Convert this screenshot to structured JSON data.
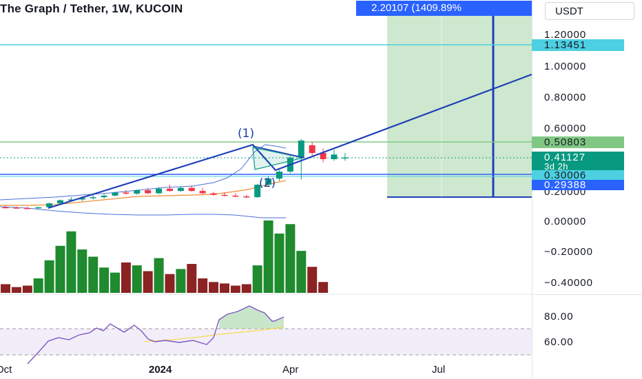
{
  "header": {
    "symbol_title": "The Graph / Tether, 1W, KUCOIN",
    "measure_label": "2.20107 (1409.89%",
    "currency": "USDT"
  },
  "price_axis": {
    "labels": [
      "1.20000",
      "1.00000",
      "0.80000",
      "0.60000",
      "0.30006",
      "0.20000",
      "0.00000",
      "−0.20000",
      "−0.40000"
    ],
    "badges": {
      "target": "1.13451",
      "resistance": "0.50803",
      "last_price": "0.41127",
      "countdown": "3d 2h",
      "support": "0.30006",
      "low": "0.29388"
    },
    "rsi_labels": [
      "80.00",
      "60.00"
    ]
  },
  "time_axis": [
    "Oct",
    "2024",
    "Apr",
    "Jul"
  ],
  "annotations": {
    "wave_1": "(1)",
    "wave_2": "(2)"
  },
  "colors": {
    "up": "#089981",
    "down": "#f23645",
    "vol_up": "#1f8a2e",
    "vol_down": "#8b2323",
    "trend": "#1f3fb8",
    "measure": "#2962ff",
    "rsi": "#7e57c2",
    "rsi_ma": "#f7d94c",
    "cyan_line": "#4dd0e1",
    "green_line": "#81c784",
    "badge_green": "#089981",
    "badge_blue": "#2962ff"
  },
  "chart_data": {
    "type": "candlestick",
    "title": "The Graph / Tether, 1W, KUCOIN",
    "price_axis_ticks": [
      1.2,
      1.0,
      0.8,
      0.6,
      0.2,
      0.0,
      -0.2,
      -0.4
    ],
    "x_ticks": [
      "Oct",
      "2024",
      "Apr",
      "Jul"
    ],
    "candles": [
      {
        "o": 0.09,
        "h": 0.1,
        "l": 0.085,
        "c": 0.088
      },
      {
        "o": 0.088,
        "h": 0.095,
        "l": 0.082,
        "c": 0.085
      },
      {
        "o": 0.085,
        "h": 0.093,
        "l": 0.08,
        "c": 0.084
      },
      {
        "o": 0.084,
        "h": 0.092,
        "l": 0.08,
        "c": 0.09
      },
      {
        "o": 0.09,
        "h": 0.12,
        "l": 0.088,
        "c": 0.115
      },
      {
        "o": 0.115,
        "h": 0.14,
        "l": 0.11,
        "c": 0.135
      },
      {
        "o": 0.135,
        "h": 0.155,
        "l": 0.125,
        "c": 0.14
      },
      {
        "o": 0.14,
        "h": 0.16,
        "l": 0.13,
        "c": 0.15
      },
      {
        "o": 0.15,
        "h": 0.17,
        "l": 0.14,
        "c": 0.155
      },
      {
        "o": 0.155,
        "h": 0.175,
        "l": 0.145,
        "c": 0.165
      },
      {
        "o": 0.165,
        "h": 0.19,
        "l": 0.16,
        "c": 0.185
      },
      {
        "o": 0.185,
        "h": 0.2,
        "l": 0.17,
        "c": 0.178
      },
      {
        "o": 0.178,
        "h": 0.205,
        "l": 0.17,
        "c": 0.2
      },
      {
        "o": 0.2,
        "h": 0.215,
        "l": 0.175,
        "c": 0.18
      },
      {
        "o": 0.18,
        "h": 0.22,
        "l": 0.175,
        "c": 0.21
      },
      {
        "o": 0.21,
        "h": 0.235,
        "l": 0.19,
        "c": 0.195
      },
      {
        "o": 0.195,
        "h": 0.225,
        "l": 0.19,
        "c": 0.215
      },
      {
        "o": 0.215,
        "h": 0.23,
        "l": 0.19,
        "c": 0.195
      },
      {
        "o": 0.195,
        "h": 0.215,
        "l": 0.175,
        "c": 0.18
      },
      {
        "o": 0.18,
        "h": 0.19,
        "l": 0.165,
        "c": 0.17
      },
      {
        "o": 0.17,
        "h": 0.185,
        "l": 0.16,
        "c": 0.165
      },
      {
        "o": 0.165,
        "h": 0.18,
        "l": 0.155,
        "c": 0.16
      },
      {
        "o": 0.16,
        "h": 0.17,
        "l": 0.15,
        "c": 0.155
      },
      {
        "o": 0.155,
        "h": 0.24,
        "l": 0.15,
        "c": 0.235
      },
      {
        "o": 0.235,
        "h": 0.29,
        "l": 0.225,
        "c": 0.275
      },
      {
        "o": 0.275,
        "h": 0.33,
        "l": 0.26,
        "c": 0.32
      },
      {
        "o": 0.32,
        "h": 0.42,
        "l": 0.31,
        "c": 0.41
      },
      {
        "o": 0.41,
        "h": 0.53,
        "l": 0.27,
        "c": 0.52
      },
      {
        "o": 0.49,
        "h": 0.51,
        "l": 0.42,
        "c": 0.44
      },
      {
        "o": 0.44,
        "h": 0.47,
        "l": 0.38,
        "c": 0.4
      },
      {
        "o": 0.4,
        "h": 0.46,
        "l": 0.39,
        "c": 0.43
      },
      {
        "o": 0.405,
        "h": 0.44,
        "l": 0.39,
        "c": 0.411
      }
    ],
    "volume_relative": [
      0.12,
      0.08,
      0.1,
      0.2,
      0.45,
      0.65,
      0.85,
      0.6,
      0.5,
      0.35,
      0.28,
      0.42,
      0.38,
      0.3,
      0.48,
      0.26,
      0.33,
      0.4,
      0.2,
      0.15,
      0.13,
      0.1,
      0.12,
      0.38,
      1.0,
      0.82,
      0.95,
      0.58,
      0.36,
      0.15
    ]
  }
}
